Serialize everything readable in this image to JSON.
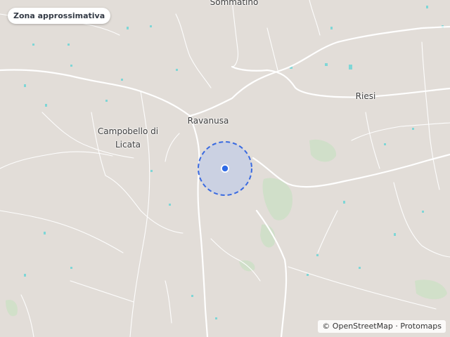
{
  "badge": {
    "label": "Zona approssimativa"
  },
  "places": {
    "sommatino": "Sommatino",
    "riesi": "Riesi",
    "ravanusa": "Ravanusa",
    "campobello": "Campobello di\nLicata"
  },
  "attribution": {
    "prefix": "©",
    "osm": "OpenStreetMap",
    "sep": "·",
    "protomaps": "Protomaps"
  },
  "colors": {
    "land": "#e2ddd8",
    "roads": "#ffffff",
    "green": "#cfe0c8",
    "water": "#7fd6d6",
    "zone_fill": "#c9cfe3",
    "zone_stroke": "#3a6ae0",
    "marker": "#2f6be6"
  }
}
